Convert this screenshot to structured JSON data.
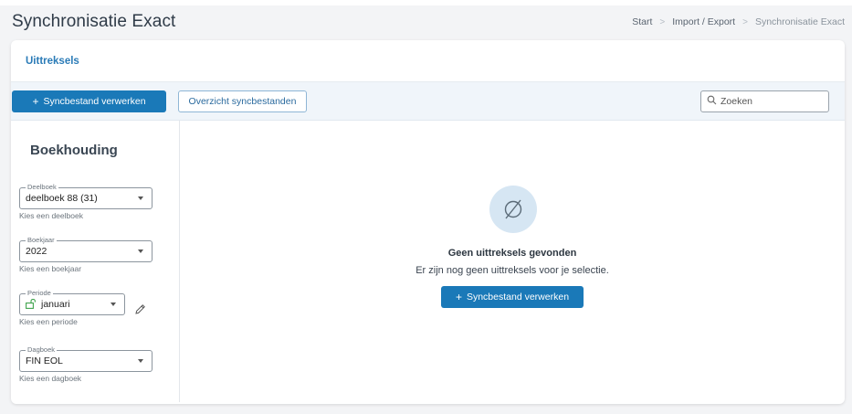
{
  "header": {
    "title": "Synchronisatie Exact",
    "breadcrumb": [
      "Start",
      "Import / Export",
      "Synchronisatie Exact"
    ]
  },
  "card": {
    "title": "Uittreksels"
  },
  "toolbar": {
    "process_label": "Syncbestand verwerken",
    "overview_label": "Overzicht syncbestanden",
    "search_placeholder": "Zoeken"
  },
  "sidebar": {
    "title": "Boekhouding",
    "fields": {
      "deelboek": {
        "legend": "Deelboek",
        "value": "deelboek 88 (31)",
        "helper": "Kies een deelboek"
      },
      "boekjaar": {
        "legend": "Boekjaar",
        "value": "2022",
        "helper": "Kies een boekjaar"
      },
      "periode": {
        "legend": "Periode",
        "value": "januari",
        "helper": "Kies een periode"
      },
      "dagboek": {
        "legend": "Dagboek",
        "value": "FIN EOL",
        "helper": "Kies een dagboek"
      }
    }
  },
  "empty_state": {
    "icon": "empty-set-icon",
    "title": "Geen uittreksels gevonden",
    "text": "Er zijn nog geen uittreksels voor je selectie.",
    "button_label": "Syncbestand verwerken"
  },
  "colors": {
    "primary": "#1a79b8",
    "link": "#2a7bb7",
    "toolbar_bg": "#f0f5fa",
    "empty_circle": "#d6e6f3",
    "lock_green": "#3fa34d"
  }
}
